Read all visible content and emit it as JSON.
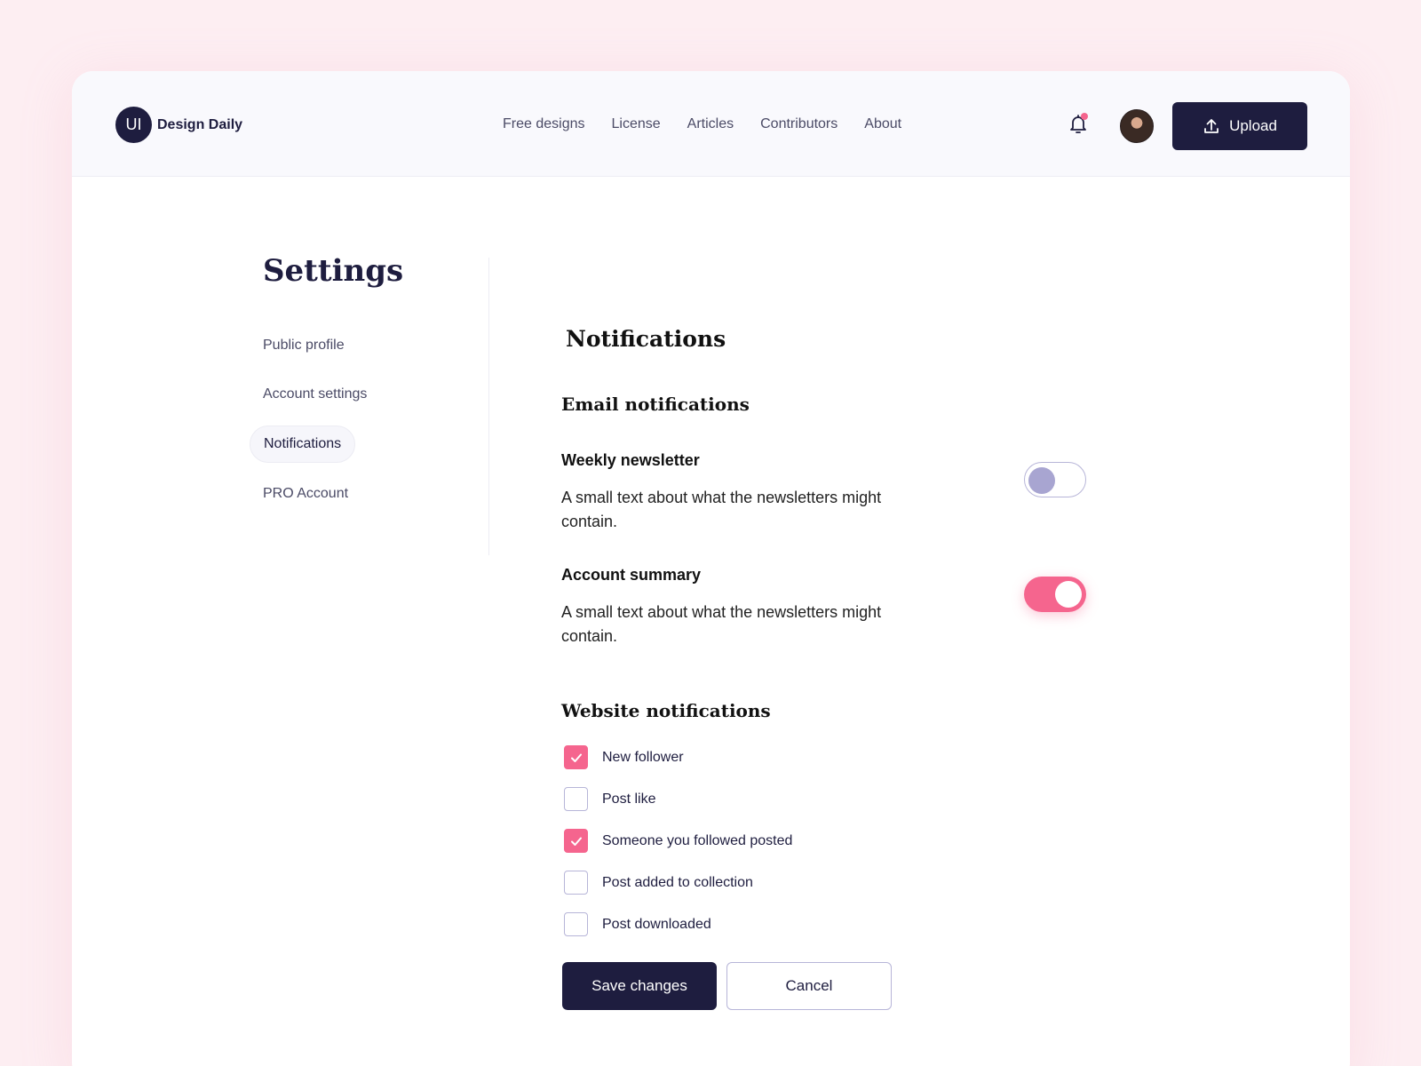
{
  "header": {
    "logo_badge": "UI",
    "logo_text": "Design Daily",
    "nav": [
      "Free designs",
      "License",
      "Articles",
      "Contributors",
      "About"
    ],
    "upload_label": "Upload",
    "notification_dot_color": "#f5658e"
  },
  "sidebar": {
    "title": "Settings",
    "items": [
      {
        "label": "Public profile",
        "active": false
      },
      {
        "label": "Account settings",
        "active": false
      },
      {
        "label": "Notifications",
        "active": true
      },
      {
        "label": "PRO Account",
        "active": false
      }
    ]
  },
  "main": {
    "heading": "Notifications",
    "email": {
      "heading": "Email notifications",
      "prefs": [
        {
          "title": "Weekly newsletter",
          "description": "A small text about what the newsletters might contain.",
          "enabled": false
        },
        {
          "title": "Account summary",
          "description": "A small text about what the newsletters might contain.",
          "enabled": true
        }
      ]
    },
    "website": {
      "heading": "Website notifications",
      "items": [
        {
          "label": "New follower",
          "checked": true
        },
        {
          "label": "Post like",
          "checked": false
        },
        {
          "label": "Someone you followed posted",
          "checked": true
        },
        {
          "label": "Post added to collection",
          "checked": false
        },
        {
          "label": "Post downloaded",
          "checked": false
        }
      ]
    },
    "save_label": "Save changes",
    "cancel_label": "Cancel"
  },
  "colors": {
    "primary": "#1e1d3f",
    "accent": "#f5658e",
    "background": "#fdeef2"
  }
}
